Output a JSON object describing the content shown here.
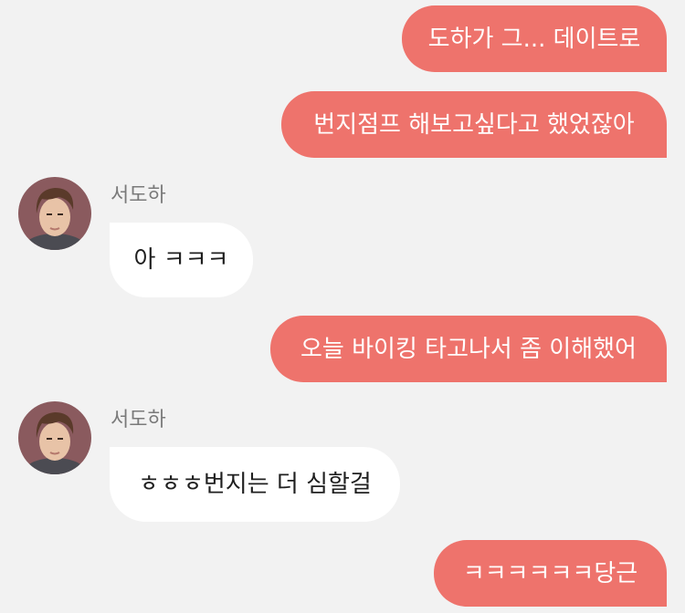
{
  "chat": {
    "contact_name": "서도하",
    "messages": [
      {
        "side": "out",
        "text": "도하가 그... 데이트로"
      },
      {
        "side": "out",
        "text": "번지점프 해보고싶다고 했었잖아"
      },
      {
        "side": "in",
        "sender": "서도하",
        "text": "아 ㅋㅋㅋ"
      },
      {
        "side": "out",
        "text": "오늘 바이킹 타고나서 좀 이해했어"
      },
      {
        "side": "in",
        "sender": "서도하",
        "text": "ㅎㅎㅎ번지는 더 심할걸"
      },
      {
        "side": "out",
        "text": "ㅋㅋㅋㅋㅋㅋ당근"
      }
    ]
  },
  "colors": {
    "background": "#f2f2f2",
    "outgoing_bubble": "#ee736c",
    "incoming_bubble": "#ffffff",
    "name_text": "#7a7a7a"
  }
}
